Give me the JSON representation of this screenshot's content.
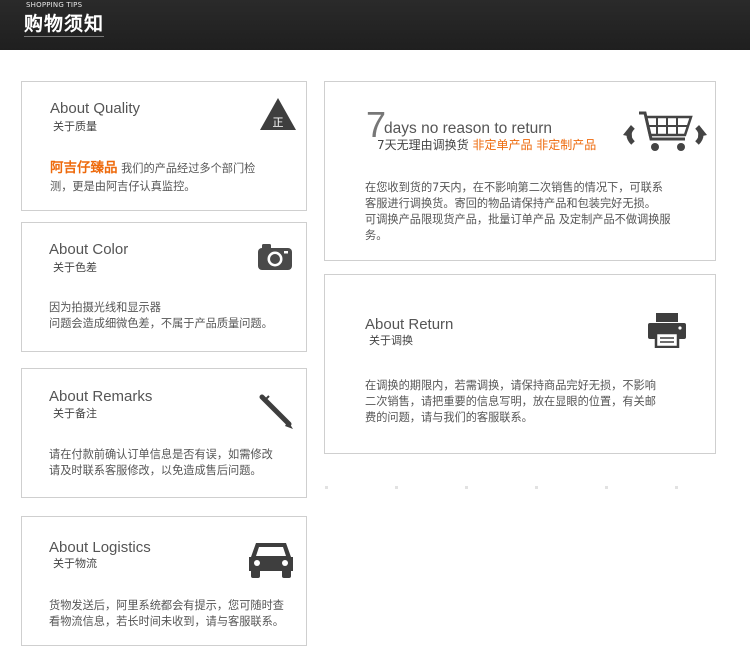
{
  "header": {
    "en_label": "SHOPPING TIPS",
    "cn_title": "购物须知"
  },
  "cards": {
    "quality": {
      "title": "About Quality",
      "subtitle": "关于质量",
      "brand": "阿吉仔臻品",
      "body_line1": "我们的产品经过多个部门检",
      "body_line2": "测，更是由阿吉仔认真监控。",
      "icon_glyph": "正"
    },
    "color": {
      "title": "About Color",
      "subtitle": "关于色差",
      "body_line1": "因为拍摄光线和显示器",
      "body_line2": "问题会造成细微色差，不属于产品质量问题。"
    },
    "remarks": {
      "title": "About Remarks",
      "subtitle": "关于备注",
      "body_line1": "请在付款前确认订单信息是否有误，如需修改",
      "body_line2": "请及时联系客服修改，以免造成售后问题。"
    },
    "logistics": {
      "title": "About Logistics",
      "subtitle": "关于物流",
      "body_line1": "货物发送后，阿里系统都会有提示，您可随时查",
      "body_line2": "看物流信息，若长时间未收到，请与客服联系。"
    },
    "return7": {
      "big_digit": "7",
      "title": "days no reason to return",
      "subtitle_plain": "7天无理由调换货 ",
      "subtitle_orange": "非定单产品 非定制产品",
      "body_line1": "在您收到货的7天内，在不影响第二次销售的情况下，可联系",
      "body_line2": "客服进行调换货。寄回的物品请保持产品和包装完好无损。",
      "body_line3": "可调换产品限现货产品，批量订单产品 及定制产品不做调换服",
      "body_line4": "务。"
    },
    "return": {
      "title": "About Return",
      "subtitle": "关于调换",
      "body_line1": "在调换的期限内，若需调换，请保持商品完好无损，不影响",
      "body_line2": "二次销售，请把重要的信息写明，放在显眼的位置，有关邮",
      "body_line3": "费的问题，请与我们的客服联系。"
    }
  }
}
